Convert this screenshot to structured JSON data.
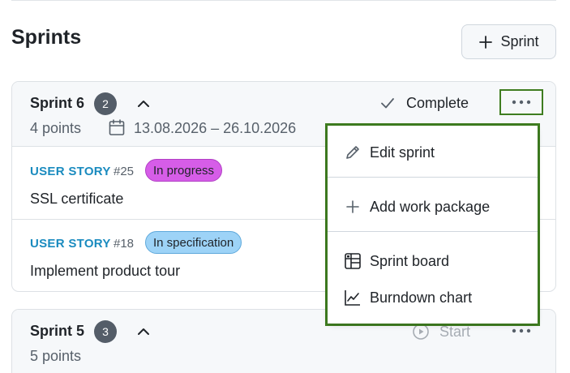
{
  "page": {
    "title": "Sprints",
    "add_sprint_label": "Sprint"
  },
  "sprints": [
    {
      "name": "Sprint 6",
      "count": "2",
      "points": "4 points",
      "dates": "13.08.2026 – 26.10.2026",
      "action_label": "Complete",
      "work_packages": [
        {
          "type": "USER STORY",
          "id": "#25",
          "status": "In progress",
          "subject": "SSL certificate"
        },
        {
          "type": "USER STORY",
          "id": "#18",
          "status": "In specification",
          "subject": "Implement product tour"
        }
      ]
    },
    {
      "name": "Sprint 5",
      "count": "3",
      "points": "5 points",
      "action_label": "Start"
    }
  ],
  "menu": {
    "edit": "Edit sprint",
    "add": "Add work package",
    "board": "Sprint board",
    "burndown": "Burndown chart"
  },
  "colors": {
    "in_progress": "#d65de8",
    "in_specification": "#9dd3f7",
    "type_text": "#1a8bbf",
    "highlight": "#3f7d20"
  },
  "icons": [
    "plus-icon",
    "chevron-up-icon",
    "calendar-icon",
    "check-icon",
    "play-icon",
    "more-icon",
    "pencil-icon",
    "board-icon",
    "chart-icon"
  ]
}
